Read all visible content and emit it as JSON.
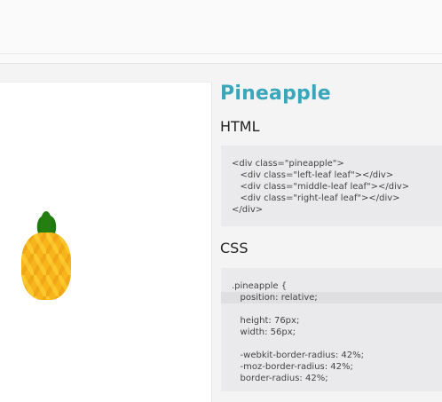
{
  "page": {
    "title": "Pineapple",
    "html_heading": "HTML",
    "css_heading": "CSS"
  },
  "html_code": [
    "<div class=\"pineapple\">",
    "   <div class=\"left-leaf leaf\"></div>",
    "   <div class=\"middle-leaf leaf\"></div>",
    "   <div class=\"right-leaf leaf\"></div>",
    "</div>"
  ],
  "css_code": [
    ".pineapple {",
    "   position: relative;",
    "",
    "   height: 76px;",
    "   width: 56px;",
    "",
    "   -webkit-border-radius: 42%;",
    "   -moz-border-radius: 42%;",
    "   border-radius: 42%;"
  ],
  "colors": {
    "accent": "#3aa6b9",
    "pineapple_body": "#f7b51b",
    "leaf": "#1f7a0e"
  }
}
